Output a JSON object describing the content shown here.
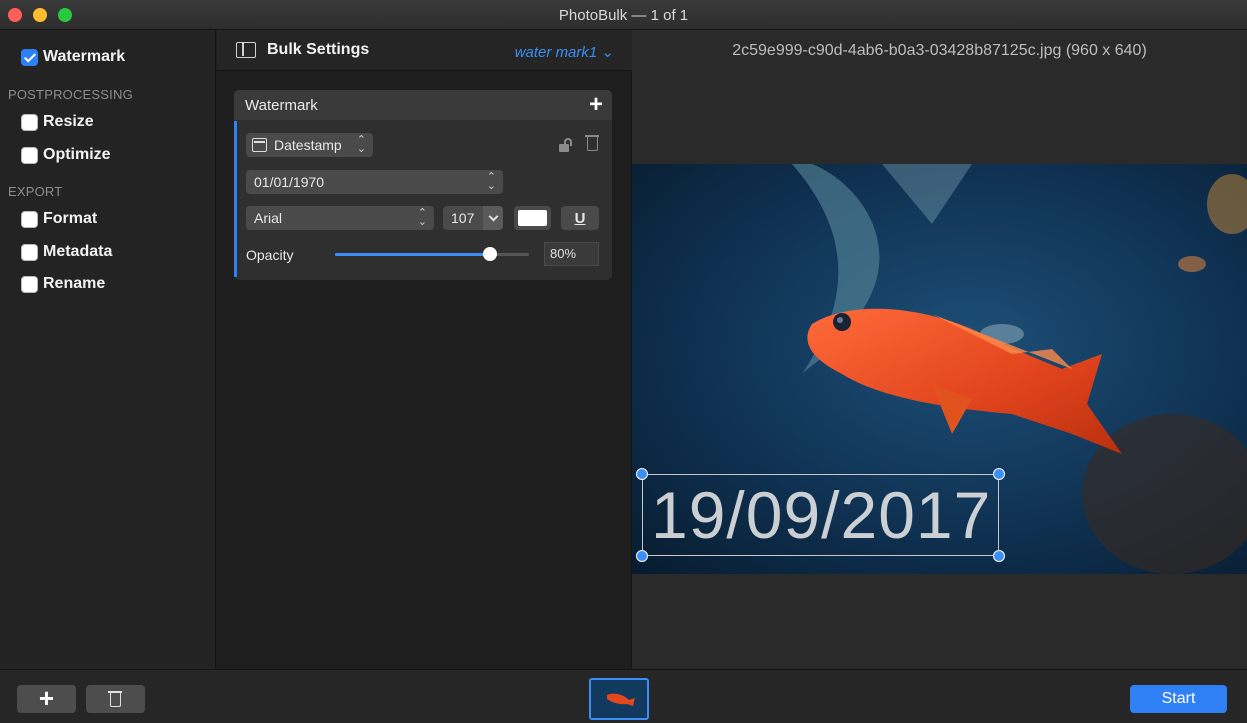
{
  "window": {
    "title": "PhotoBulk — 1 of 1"
  },
  "sidebar": {
    "watermark_label": "Watermark",
    "watermark_checked": true,
    "postprocessing_header": "POSTPROCESSING",
    "resize_label": "Resize",
    "optimize_label": "Optimize",
    "export_header": "EXPORT",
    "format_label": "Format",
    "metadata_label": "Metadata",
    "rename_label": "Rename"
  },
  "settings": {
    "title": "Bulk Settings",
    "preset": "water mark1"
  },
  "watermark_card": {
    "title": "Watermark",
    "add_symbol": "+",
    "type": "Datestamp",
    "date_format": "01/01/1970",
    "font": "Arial",
    "font_size": "107",
    "text_color": "#ffffff",
    "underline_label": "U",
    "opacity_label": "Opacity",
    "opacity_value": "80%",
    "opacity_level": 0.8
  },
  "preview": {
    "file_info": "2c59e999-c90d-4ab6-b0a3-03428b87125c.jpg (960 x 640)",
    "watermark_text": "19/09/2017"
  },
  "bottom": {
    "add_symbol": "+",
    "start_label": "Start"
  },
  "colors": {
    "accent": "#2f7ff5",
    "background": "#1e1e1e"
  }
}
